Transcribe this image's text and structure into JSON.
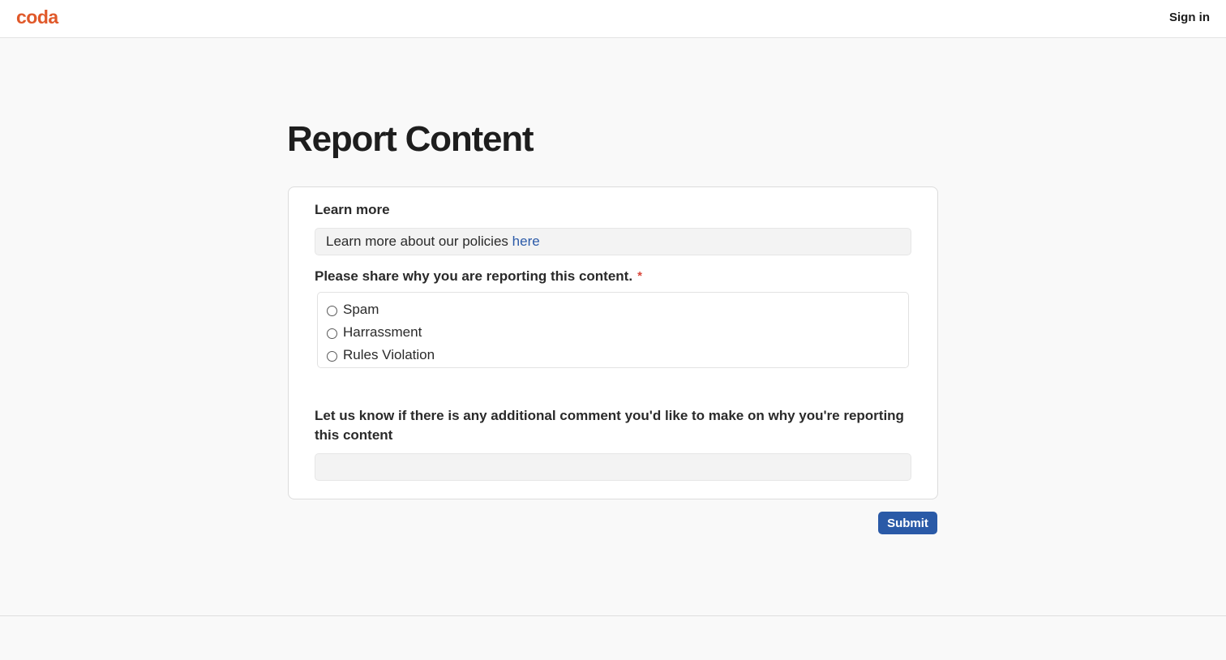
{
  "header": {
    "logo_text": "coda",
    "sign_in_label": "Sign in"
  },
  "page": {
    "title": "Report Content"
  },
  "form": {
    "learn_more": {
      "label": "Learn more",
      "text": "Learn more about our policies",
      "link_text": "here"
    },
    "reason": {
      "label": "Please share why you are reporting this content.",
      "required_marker": "*",
      "options": [
        {
          "label": "Spam",
          "selected": false
        },
        {
          "label": "Harrassment",
          "selected": false
        },
        {
          "label": "Rules Violation",
          "selected": false
        }
      ]
    },
    "comment": {
      "label": "Let us know if there is any additional comment you'd like to make on why you're reporting this content",
      "value": "",
      "placeholder": ""
    },
    "submit_label": "Submit"
  },
  "colors": {
    "brand": "#e0592a",
    "link": "#2b5aa8",
    "button": "#2a5aa7",
    "required": "#d9463a"
  }
}
